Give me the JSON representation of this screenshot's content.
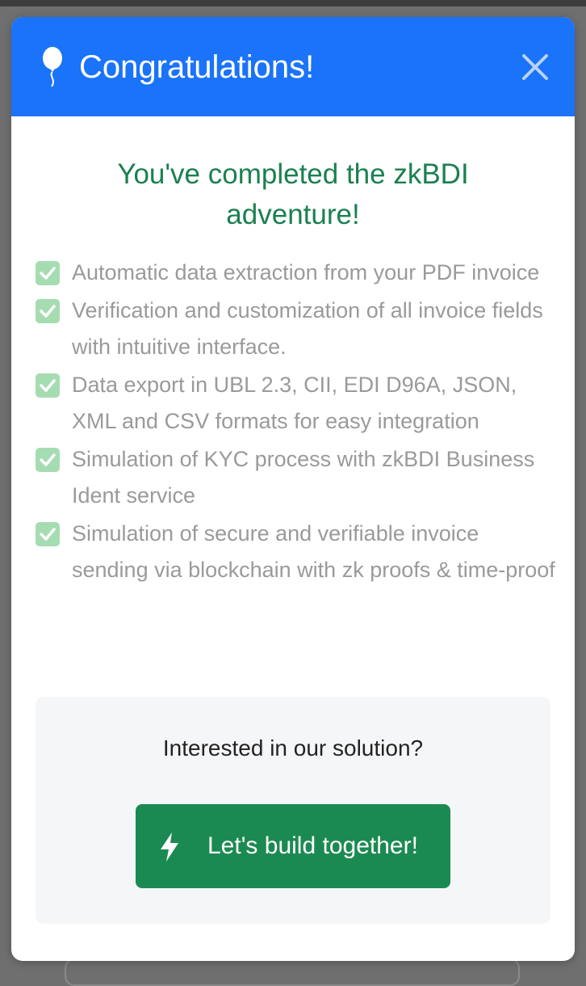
{
  "modal": {
    "title": "Congratulations!",
    "header_color": "#1a73f8",
    "icons": {
      "header": "balloon-icon",
      "close": "close-icon",
      "check": "check-icon",
      "cta": "lightning-bolt-icon"
    }
  },
  "content": {
    "headline": "You've completed the zkBDI adventure!",
    "headline_color": "#1b8050",
    "features": [
      {
        "text": "Automatic data extraction from your PDF invoice",
        "checked": true
      },
      {
        "text": "Verification and customization of all invoice fields with intuitive interface.",
        "checked": true
      },
      {
        "text": "Data export in UBL 2.3, CII, EDI D96A, JSON, XML and CSV formats for easy integration",
        "checked": true
      },
      {
        "text": "Simulation of KYC process with zkBDI Business Ident service",
        "checked": true
      },
      {
        "text": "Simulation of secure and verifiable invoice sending via blockchain with zk proofs & time-proof",
        "checked": true
      }
    ]
  },
  "cta": {
    "question": "Interested in our solution?",
    "button_label": "Let's build together!",
    "button_color": "#1b8a52"
  }
}
